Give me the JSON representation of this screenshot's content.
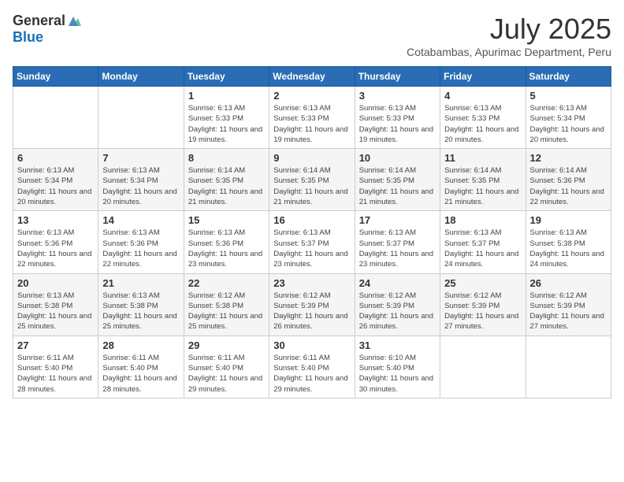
{
  "logo": {
    "general": "General",
    "blue": "Blue"
  },
  "title": "July 2025",
  "location": "Cotabambas, Apurimac Department, Peru",
  "weekdays": [
    "Sunday",
    "Monday",
    "Tuesday",
    "Wednesday",
    "Thursday",
    "Friday",
    "Saturday"
  ],
  "weeks": [
    [
      {
        "day": "",
        "info": ""
      },
      {
        "day": "",
        "info": ""
      },
      {
        "day": "1",
        "info": "Sunrise: 6:13 AM\nSunset: 5:33 PM\nDaylight: 11 hours and 19 minutes."
      },
      {
        "day": "2",
        "info": "Sunrise: 6:13 AM\nSunset: 5:33 PM\nDaylight: 11 hours and 19 minutes."
      },
      {
        "day": "3",
        "info": "Sunrise: 6:13 AM\nSunset: 5:33 PM\nDaylight: 11 hours and 19 minutes."
      },
      {
        "day": "4",
        "info": "Sunrise: 6:13 AM\nSunset: 5:33 PM\nDaylight: 11 hours and 20 minutes."
      },
      {
        "day": "5",
        "info": "Sunrise: 6:13 AM\nSunset: 5:34 PM\nDaylight: 11 hours and 20 minutes."
      }
    ],
    [
      {
        "day": "6",
        "info": "Sunrise: 6:13 AM\nSunset: 5:34 PM\nDaylight: 11 hours and 20 minutes."
      },
      {
        "day": "7",
        "info": "Sunrise: 6:13 AM\nSunset: 5:34 PM\nDaylight: 11 hours and 20 minutes."
      },
      {
        "day": "8",
        "info": "Sunrise: 6:14 AM\nSunset: 5:35 PM\nDaylight: 11 hours and 21 minutes."
      },
      {
        "day": "9",
        "info": "Sunrise: 6:14 AM\nSunset: 5:35 PM\nDaylight: 11 hours and 21 minutes."
      },
      {
        "day": "10",
        "info": "Sunrise: 6:14 AM\nSunset: 5:35 PM\nDaylight: 11 hours and 21 minutes."
      },
      {
        "day": "11",
        "info": "Sunrise: 6:14 AM\nSunset: 5:35 PM\nDaylight: 11 hours and 21 minutes."
      },
      {
        "day": "12",
        "info": "Sunrise: 6:14 AM\nSunset: 5:36 PM\nDaylight: 11 hours and 22 minutes."
      }
    ],
    [
      {
        "day": "13",
        "info": "Sunrise: 6:13 AM\nSunset: 5:36 PM\nDaylight: 11 hours and 22 minutes."
      },
      {
        "day": "14",
        "info": "Sunrise: 6:13 AM\nSunset: 5:36 PM\nDaylight: 11 hours and 22 minutes."
      },
      {
        "day": "15",
        "info": "Sunrise: 6:13 AM\nSunset: 5:36 PM\nDaylight: 11 hours and 23 minutes."
      },
      {
        "day": "16",
        "info": "Sunrise: 6:13 AM\nSunset: 5:37 PM\nDaylight: 11 hours and 23 minutes."
      },
      {
        "day": "17",
        "info": "Sunrise: 6:13 AM\nSunset: 5:37 PM\nDaylight: 11 hours and 23 minutes."
      },
      {
        "day": "18",
        "info": "Sunrise: 6:13 AM\nSunset: 5:37 PM\nDaylight: 11 hours and 24 minutes."
      },
      {
        "day": "19",
        "info": "Sunrise: 6:13 AM\nSunset: 5:38 PM\nDaylight: 11 hours and 24 minutes."
      }
    ],
    [
      {
        "day": "20",
        "info": "Sunrise: 6:13 AM\nSunset: 5:38 PM\nDaylight: 11 hours and 25 minutes."
      },
      {
        "day": "21",
        "info": "Sunrise: 6:13 AM\nSunset: 5:38 PM\nDaylight: 11 hours and 25 minutes."
      },
      {
        "day": "22",
        "info": "Sunrise: 6:12 AM\nSunset: 5:38 PM\nDaylight: 11 hours and 25 minutes."
      },
      {
        "day": "23",
        "info": "Sunrise: 6:12 AM\nSunset: 5:39 PM\nDaylight: 11 hours and 26 minutes."
      },
      {
        "day": "24",
        "info": "Sunrise: 6:12 AM\nSunset: 5:39 PM\nDaylight: 11 hours and 26 minutes."
      },
      {
        "day": "25",
        "info": "Sunrise: 6:12 AM\nSunset: 5:39 PM\nDaylight: 11 hours and 27 minutes."
      },
      {
        "day": "26",
        "info": "Sunrise: 6:12 AM\nSunset: 5:39 PM\nDaylight: 11 hours and 27 minutes."
      }
    ],
    [
      {
        "day": "27",
        "info": "Sunrise: 6:11 AM\nSunset: 5:40 PM\nDaylight: 11 hours and 28 minutes."
      },
      {
        "day": "28",
        "info": "Sunrise: 6:11 AM\nSunset: 5:40 PM\nDaylight: 11 hours and 28 minutes."
      },
      {
        "day": "29",
        "info": "Sunrise: 6:11 AM\nSunset: 5:40 PM\nDaylight: 11 hours and 29 minutes."
      },
      {
        "day": "30",
        "info": "Sunrise: 6:11 AM\nSunset: 5:40 PM\nDaylight: 11 hours and 29 minutes."
      },
      {
        "day": "31",
        "info": "Sunrise: 6:10 AM\nSunset: 5:40 PM\nDaylight: 11 hours and 30 minutes."
      },
      {
        "day": "",
        "info": ""
      },
      {
        "day": "",
        "info": ""
      }
    ]
  ]
}
